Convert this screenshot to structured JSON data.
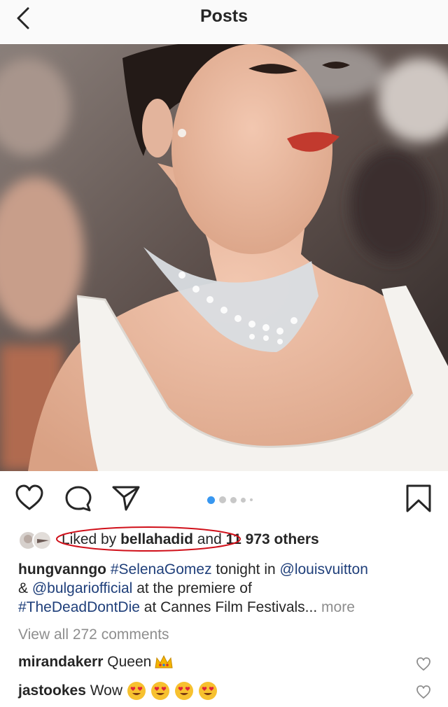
{
  "header": {
    "title": "Posts"
  },
  "post": {
    "carousel": {
      "dot_count": 5,
      "active_index": 0
    },
    "likes": {
      "prefix": "Liked by ",
      "user": "bellahadid",
      "middle": " and ",
      "count": "11 973 others"
    },
    "caption": {
      "username": "hungvanngo",
      "hashtag1": "#SelenaGomez",
      "text1": " tonight in ",
      "mention1": "@louisvuitton",
      "text2": "& ",
      "mention2": "@bulgariofficial",
      "text3": " at the premiere of",
      "hashtag2": "#TheDeadDontDie",
      "text4": " at Cannes Film Festivals...",
      "more": "more"
    },
    "view_all_comments": "View all 272 comments",
    "comments": [
      {
        "username": "mirandakerr",
        "text": "Queen",
        "emoji": [
          "crown"
        ]
      },
      {
        "username": "jastookes",
        "text": "Wow",
        "emoji": [
          "heart-eyes",
          "heart-eyes",
          "heart-eyes",
          "heart-eyes"
        ]
      }
    ]
  },
  "colors": {
    "text": "#262626",
    "link": "#1f3f7a",
    "muted": "#8e8e8e",
    "carousel_active": "#3897f0",
    "annotation_red": "#d0101a"
  }
}
